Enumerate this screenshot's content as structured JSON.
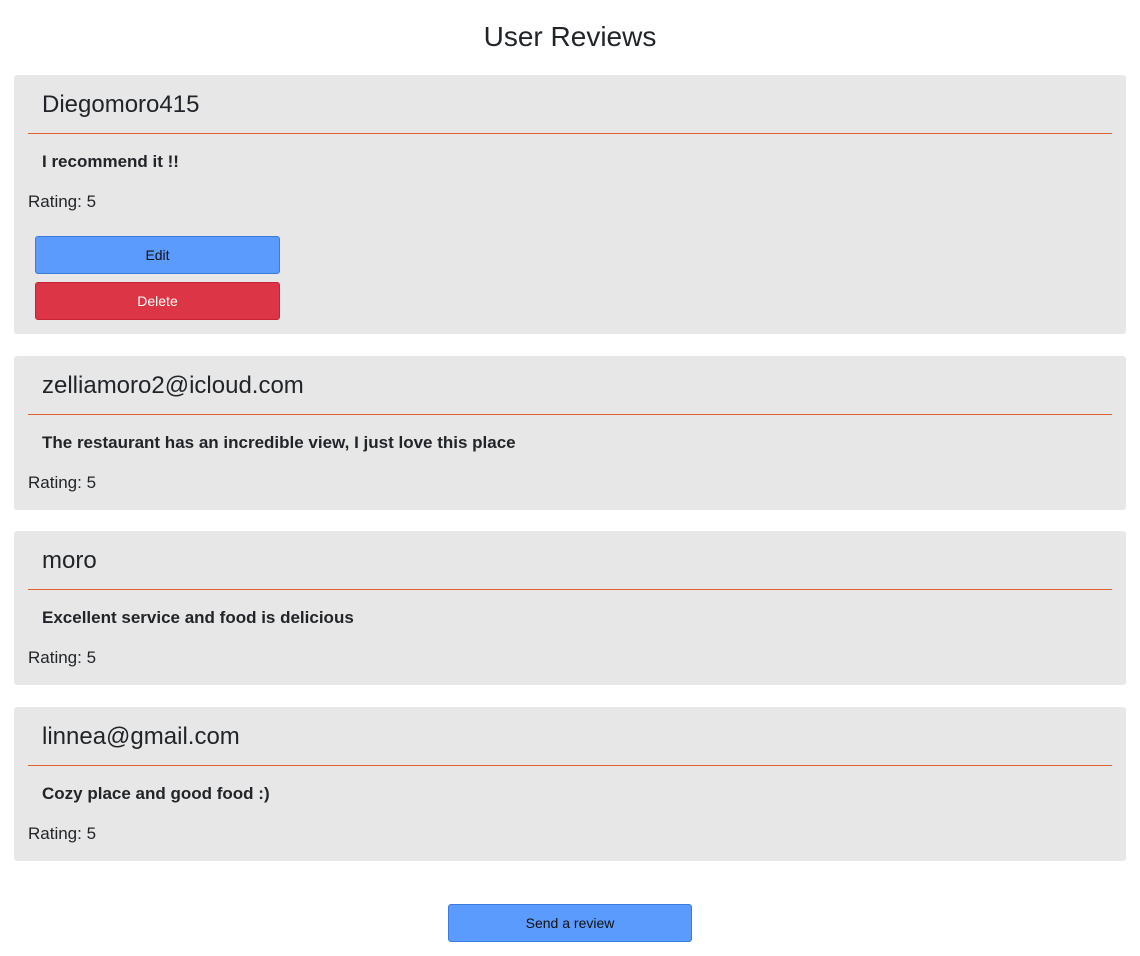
{
  "page": {
    "title": "User Reviews"
  },
  "reviews": [
    {
      "author": "Diegomoro415",
      "comment": "I recommend it !!",
      "rating_text": "Rating: 5",
      "rating": 5,
      "actions": {
        "edit_label": "Edit",
        "delete_label": "Delete"
      }
    },
    {
      "author": "zelliamoro2@icloud.com",
      "comment": "The restaurant has an incredible view, I just love this place",
      "rating_text": "Rating: 5",
      "rating": 5
    },
    {
      "author": "moro",
      "comment": "Excellent service and food is delicious",
      "rating_text": "Rating: 5",
      "rating": 5
    },
    {
      "author": "linnea@gmail.com",
      "comment": "Cozy place and good food :)",
      "rating_text": "Rating: 5",
      "rating": 5
    }
  ],
  "footer": {
    "send_review_label": "Send a review"
  },
  "colors": {
    "card_background": "#e7e7e7",
    "divider": "#e0602f",
    "primary_button": "#5b9bfd",
    "danger_button": "#dc3545"
  }
}
